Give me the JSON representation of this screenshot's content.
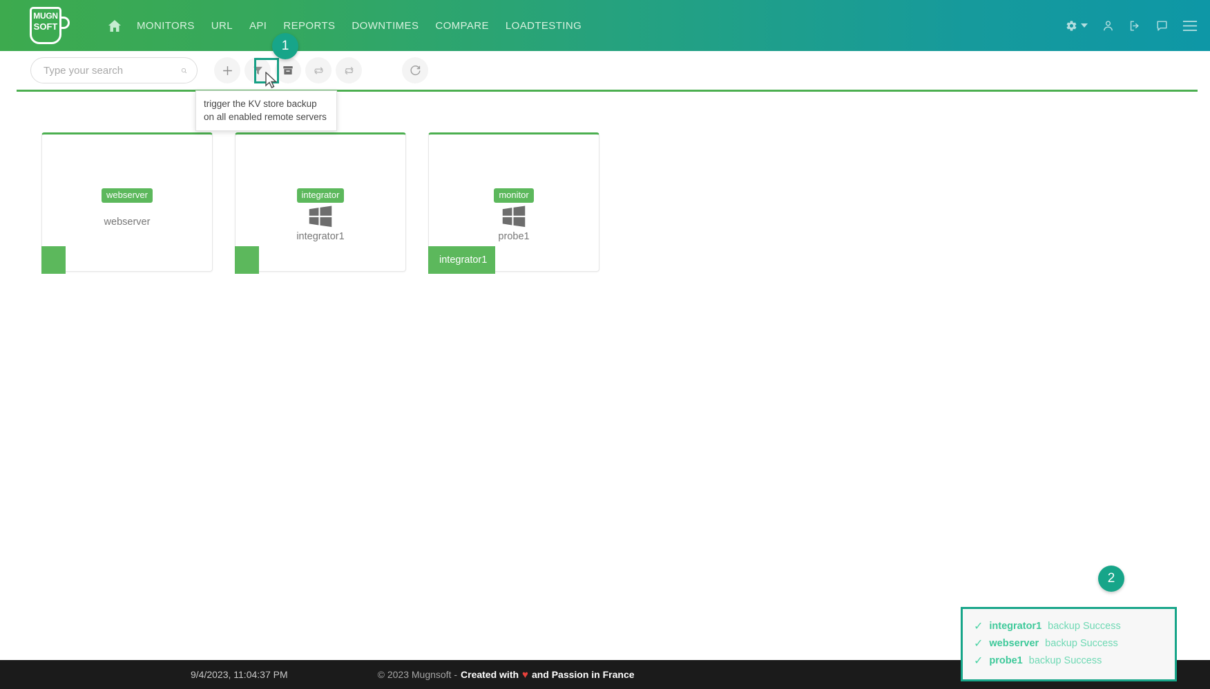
{
  "header": {
    "logo": {
      "line1": "MUGN",
      "line2": "SOFT",
      "icon": "coffee-mug-logo"
    },
    "nav": [
      {
        "label": "",
        "icon": "home-icon",
        "name": "nav-home"
      },
      {
        "label": "MONITORS",
        "name": "nav-monitors"
      },
      {
        "label": "URL",
        "name": "nav-url"
      },
      {
        "label": "API",
        "name": "nav-api"
      },
      {
        "label": "REPORTS",
        "name": "nav-reports"
      },
      {
        "label": "DOWNTIMES",
        "name": "nav-downtimes"
      },
      {
        "label": "COMPARE",
        "name": "nav-compare"
      },
      {
        "label": "LOADTESTING",
        "name": "nav-loadtesting"
      }
    ],
    "right_icons": [
      "gear-icon",
      "chevron-down-icon",
      "user-icon",
      "logout-icon",
      "chat-icon",
      "hamburger-menu-icon"
    ],
    "gradient_from": "#3daa4e",
    "gradient_to": "#0e97a6"
  },
  "toolbar": {
    "search": {
      "placeholder": "Type your search",
      "value": ""
    },
    "buttons": [
      {
        "name": "add-button",
        "icon": "plus-icon"
      },
      {
        "name": "filter-button",
        "icon": "funnel-icon"
      },
      {
        "name": "backup-button",
        "icon": "archive-box-icon"
      },
      {
        "name": "sync-button",
        "icon": "sync-arrows-icon"
      },
      {
        "name": "repeat-button",
        "icon": "repeat-arrows-icon"
      },
      {
        "name": "reload-button",
        "icon": "reload-icon"
      }
    ]
  },
  "tooltip": {
    "text": "trigger the KV store backup on all enabled remote servers"
  },
  "annotations": {
    "badge1": "1",
    "badge2": "2",
    "accent": "#17a589"
  },
  "cards": [
    {
      "chip": "webserver",
      "label": "webserver",
      "os_icon": "none",
      "corner_chip": "",
      "accent": "#4caf50"
    },
    {
      "chip": "integrator",
      "label": "integrator1",
      "os_icon": "windows-icon",
      "corner_chip": "",
      "accent": "#4caf50"
    },
    {
      "chip": "monitor",
      "label": "probe1",
      "os_icon": "windows-icon",
      "corner_chip": "integrator1",
      "accent": "#4caf50"
    }
  ],
  "toast": {
    "items": [
      {
        "name": "integrator1",
        "text": "backup Success"
      },
      {
        "name": "webserver",
        "text": "backup Success"
      },
      {
        "name": "probe1",
        "text": "backup Success"
      }
    ],
    "border_color": "#17a589"
  },
  "footer": {
    "datetime": "9/4/2023, 11:04:37 PM",
    "copyright": "© 2023 Mugnsoft -",
    "created": "Created with",
    "heart": "♥",
    "passion": "and Passion in France"
  }
}
